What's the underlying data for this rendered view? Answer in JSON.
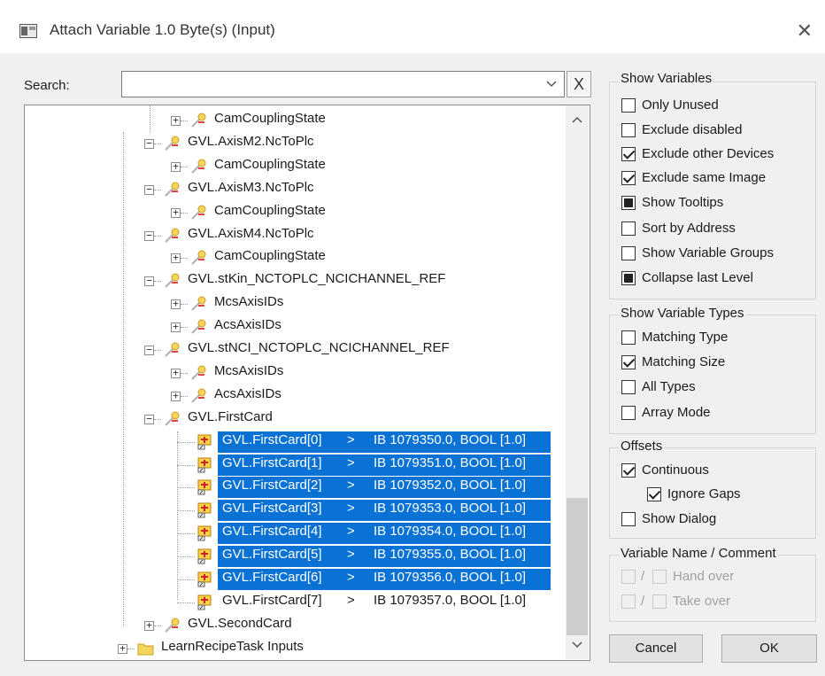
{
  "window": {
    "title": "Attach Variable 1.0 Byte(s) (Input)"
  },
  "search": {
    "label": "Search:",
    "value": "",
    "clear": "X"
  },
  "tree": {
    "nodes": [
      {
        "label": "CamCouplingState"
      },
      {
        "label": "GVL.AxisM2.NcToPlc"
      },
      {
        "label": "CamCouplingState"
      },
      {
        "label": "GVL.AxisM3.NcToPlc"
      },
      {
        "label": "CamCouplingState"
      },
      {
        "label": "GVL.AxisM4.NcToPlc"
      },
      {
        "label": "CamCouplingState"
      },
      {
        "label": "GVL.stKin_NCTOPLC_NCICHANNEL_REF"
      },
      {
        "label": "McsAxisIDs"
      },
      {
        "label": "AcsAxisIDs"
      },
      {
        "label": "GVL.stNCI_NCTOPLC_NCICHANNEL_REF"
      },
      {
        "label": "McsAxisIDs"
      },
      {
        "label": "AcsAxisIDs"
      },
      {
        "label": "GVL.FirstCard"
      },
      {
        "label": "GVL.FirstCard[0]",
        "arrow": ">",
        "info": "IB 1079350.0, BOOL [1.0]"
      },
      {
        "label": "GVL.FirstCard[1]",
        "arrow": ">",
        "info": "IB 1079351.0, BOOL [1.0]"
      },
      {
        "label": "GVL.FirstCard[2]",
        "arrow": ">",
        "info": "IB 1079352.0, BOOL [1.0]"
      },
      {
        "label": "GVL.FirstCard[3]",
        "arrow": ">",
        "info": "IB 1079353.0, BOOL [1.0]"
      },
      {
        "label": "GVL.FirstCard[4]",
        "arrow": ">",
        "info": "IB 1079354.0, BOOL [1.0]"
      },
      {
        "label": "GVL.FirstCard[5]",
        "arrow": ">",
        "info": "IB 1079355.0, BOOL [1.0]"
      },
      {
        "label": "GVL.FirstCard[6]",
        "arrow": ">",
        "info": "IB 1079356.0, BOOL [1.0]"
      },
      {
        "label": "GVL.FirstCard[7]",
        "arrow": ">",
        "info": "IB 1079357.0, BOOL [1.0]"
      },
      {
        "label": "GVL.SecondCard"
      },
      {
        "label": "LearnRecipeTask Inputs"
      }
    ]
  },
  "show_variables": {
    "title": "Show Variables",
    "options": [
      {
        "label": "Only Unused",
        "state": "unchecked"
      },
      {
        "label": "Exclude disabled",
        "state": "unchecked"
      },
      {
        "label": "Exclude other Devices",
        "state": "checked"
      },
      {
        "label": "Exclude same Image",
        "state": "checked"
      },
      {
        "label": "Show Tooltips",
        "state": "indeterminate"
      },
      {
        "label": "Sort by Address",
        "state": "unchecked"
      },
      {
        "label": "Show Variable Groups",
        "state": "unchecked"
      },
      {
        "label": "Collapse last Level",
        "state": "indeterminate"
      }
    ]
  },
  "show_variable_types": {
    "title": "Show Variable Types",
    "options": [
      {
        "label": "Matching Type",
        "state": "unchecked"
      },
      {
        "label": "Matching Size",
        "state": "checked"
      },
      {
        "label": "All Types",
        "state": "unchecked"
      },
      {
        "label": "Array Mode",
        "state": "unchecked"
      }
    ]
  },
  "offsets": {
    "title": "Offsets",
    "options": [
      {
        "label": "Continuous",
        "state": "checked"
      },
      {
        "label": "Ignore Gaps",
        "state": "checked"
      },
      {
        "label": "Show Dialog",
        "state": "unchecked"
      }
    ]
  },
  "name_comment": {
    "title": "Variable Name / Comment",
    "slash": "/",
    "options": [
      {
        "label": "Hand over",
        "state": "disabled"
      },
      {
        "label": "Take over",
        "state": "disabled"
      }
    ]
  },
  "buttons": {
    "cancel": "Cancel",
    "ok": "OK"
  }
}
